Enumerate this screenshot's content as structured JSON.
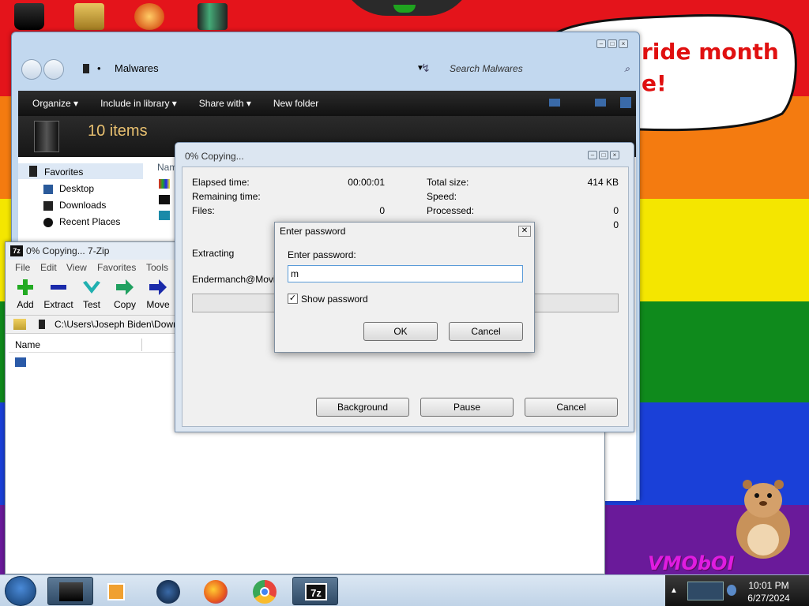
{
  "desktop": {
    "banner_text_line1": "ride month",
    "banner_text_line2": "e!",
    "watermark": "VMObOI",
    "stripe_colors": [
      "#e4141b",
      "#f47b10",
      "#f4e600",
      "#0f8a1c",
      "#1a40d8",
      "#6a1a9a"
    ]
  },
  "explorer": {
    "location": "Malwares",
    "search_placeholder": "Search Malwares",
    "toolbar": {
      "organize": "Organize ▾",
      "include_in_library": "Include in library ▾",
      "share_with": "Share with ▾",
      "new_folder": "New folder"
    },
    "item_count": "10 items",
    "column_name": "Nam",
    "nav": {
      "favorites": "Favorites",
      "desktop": "Desktop",
      "downloads": "Downloads",
      "recent_places": "Recent Places"
    }
  },
  "sevenzip": {
    "title": "0% Copying... 7-Zip",
    "logo": "7z",
    "menu": [
      "File",
      "Edit",
      "View",
      "Favorites",
      "Tools"
    ],
    "tools": {
      "add": "Add",
      "extract": "Extract",
      "test": "Test",
      "copy": "Copy",
      "move": "Move"
    },
    "path": "C:\\Users\\Joseph Biden\\Down",
    "column_name": "Name"
  },
  "copying": {
    "title": "0% Copying...",
    "elapsed_label": "Elapsed time:",
    "elapsed_value": "00:00:01",
    "remaining_label": "Remaining time:",
    "files_label": "Files:",
    "files_value": "0",
    "total_size_label": "Total size:",
    "total_size_value": "414 KB",
    "speed_label": "Speed:",
    "processed_label": "Processed:",
    "processed_value": "0",
    "compressed_value": "0",
    "extracting_label": "Extracting",
    "current_file": "Endermanch@Movie.n",
    "progress": 0,
    "btn_background": "Background",
    "btn_pause": "Pause",
    "btn_cancel": "Cancel"
  },
  "password_dialog": {
    "title": "Enter password",
    "label": "Enter password:",
    "value": "m",
    "show_password_label": "Show password",
    "show_password_checked": "✓",
    "ok": "OK",
    "cancel": "Cancel"
  },
  "taskbar": {
    "tray_app": "7z",
    "time": "10:01 PM",
    "date": "6/27/2024"
  }
}
